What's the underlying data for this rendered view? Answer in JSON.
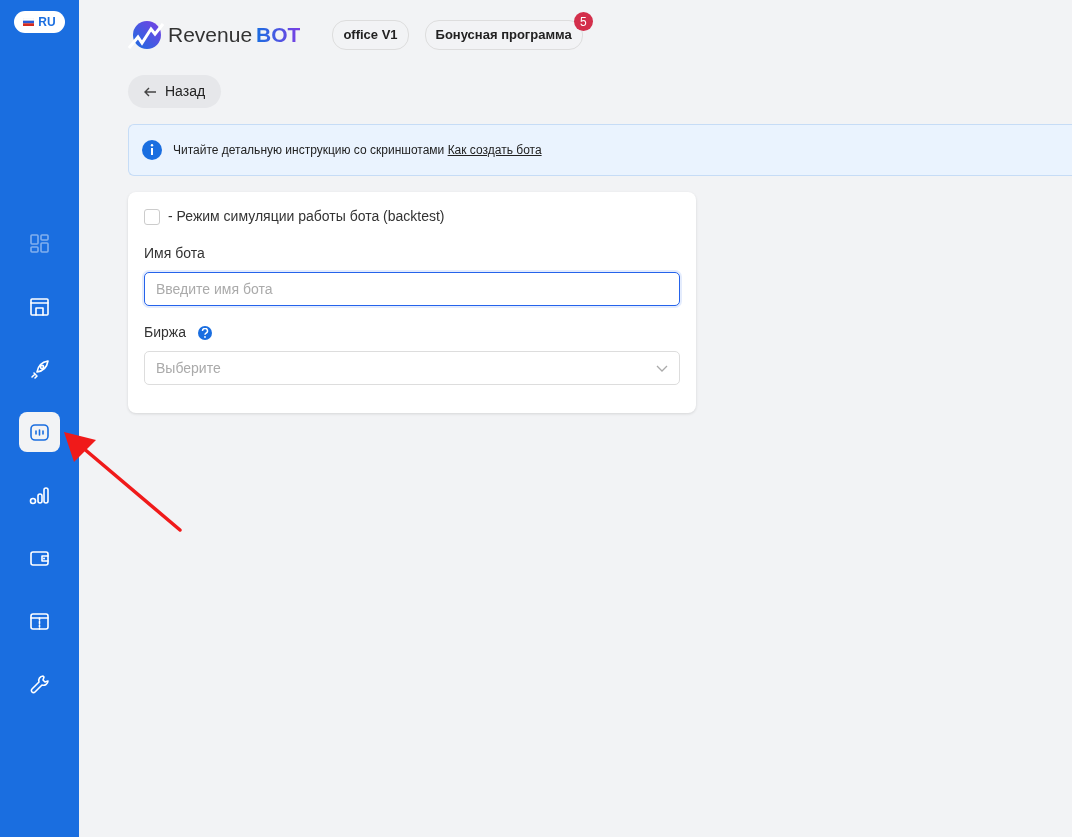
{
  "sidebar": {
    "language": "RU",
    "items": [
      {
        "selected": false,
        "disabled": true
      },
      {
        "selected": false,
        "disabled": false
      },
      {
        "selected": false,
        "disabled": false
      },
      {
        "selected": true,
        "disabled": false
      },
      {
        "selected": false,
        "disabled": false
      },
      {
        "selected": false,
        "disabled": false
      },
      {
        "selected": false,
        "disabled": false
      },
      {
        "selected": false,
        "disabled": false
      }
    ]
  },
  "header": {
    "logo_text": "Revenue",
    "logo_bold": "BOT",
    "pills": [
      {
        "label": "office V1"
      },
      {
        "label": "Бонусная программа",
        "badge": "5"
      }
    ]
  },
  "back_button": "Назад",
  "info_alert": {
    "text": "Читайте детальную инструкцию со скриншотами",
    "link": "Как создать бота"
  },
  "form": {
    "backtest": {
      "label": "- Режим симуляции работы бота (backtest)",
      "checked": false
    },
    "name_field": {
      "label": "Имя бота",
      "placeholder": "Введите имя бота",
      "focused": true
    },
    "exchange_field": {
      "label": "Биржа",
      "placeholder": "Выберите"
    }
  }
}
